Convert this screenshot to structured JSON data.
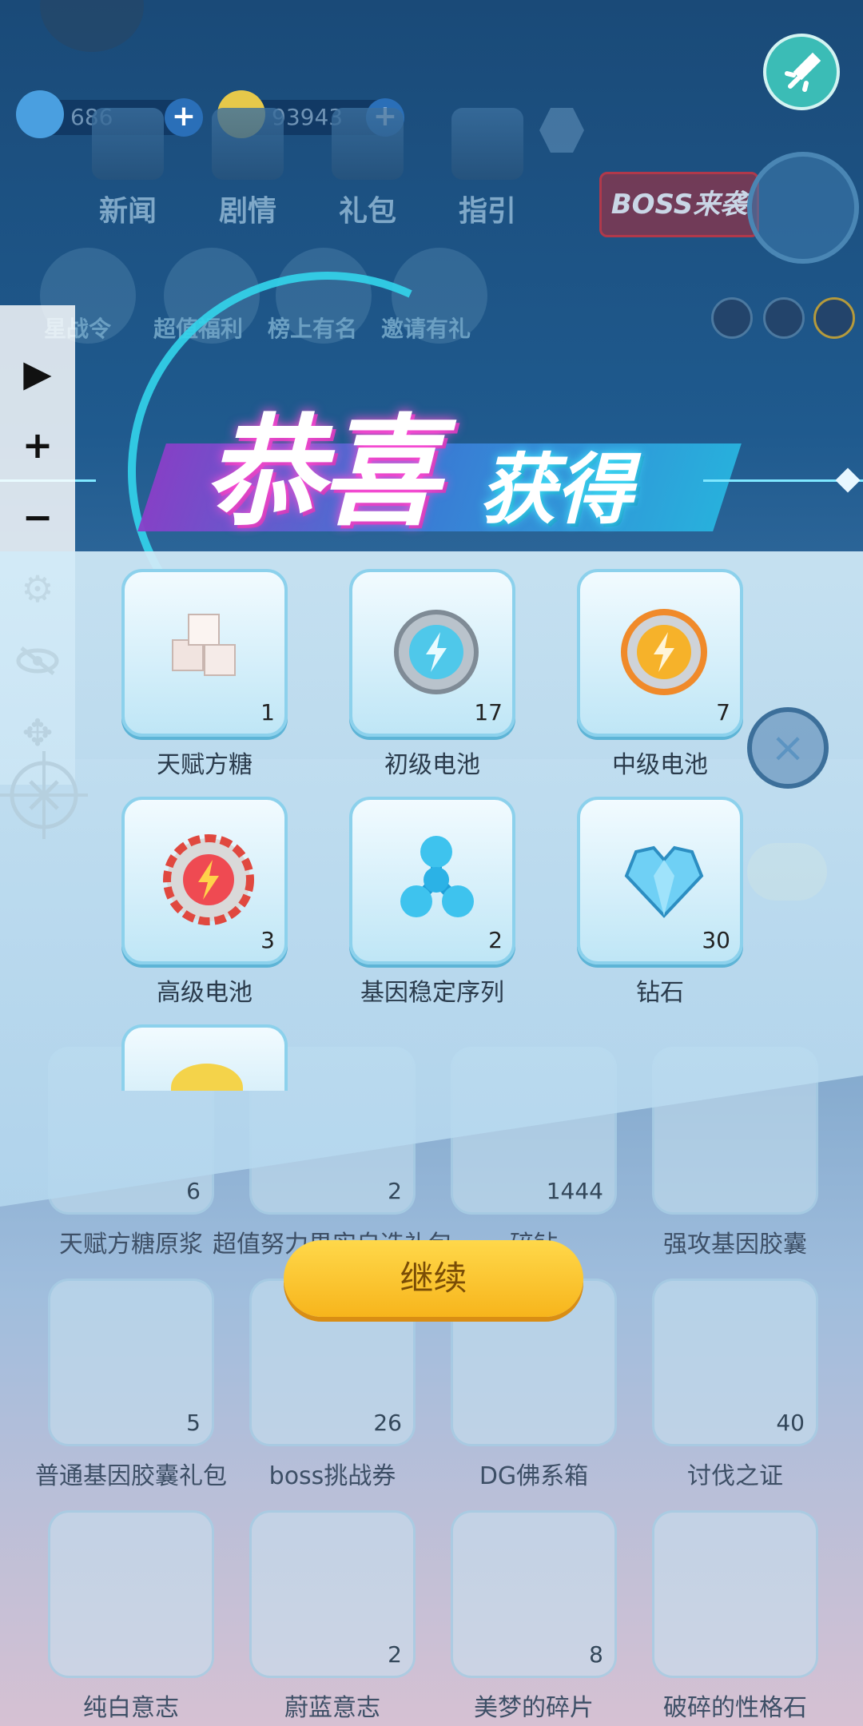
{
  "hud": {
    "gem_count": "686",
    "coin_count": "93943",
    "nav": [
      "新闻",
      "剧情",
      "礼包",
      "指引"
    ],
    "events": [
      "星战令",
      "超值福利",
      "榜上有名",
      "邀请有礼"
    ],
    "boss_label": "BOSS来袭"
  },
  "tools": [
    "play-icon",
    "plus-icon",
    "minus-icon",
    "gear-icon",
    "eye-off-icon",
    "move-icon",
    "crosshair-icon"
  ],
  "banner": {
    "title_a": "恭喜",
    "title_b": "获得"
  },
  "rewards": [
    {
      "name": "天赋方糖",
      "count": "1",
      "icon": "sugar-cube-icon"
    },
    {
      "name": "初级电池",
      "count": "17",
      "icon": "battery-blue-icon"
    },
    {
      "name": "中级电池",
      "count": "7",
      "icon": "battery-orange-icon"
    },
    {
      "name": "高级电池",
      "count": "3",
      "icon": "battery-red-icon"
    },
    {
      "name": "基因稳定序列",
      "count": "2",
      "icon": "molecule-icon"
    },
    {
      "name": "钻石",
      "count": "30",
      "icon": "diamond-heart-icon"
    }
  ],
  "background_grid": [
    {
      "name": "天赋方糖原浆",
      "count": "6"
    },
    {
      "name": "超值努力果实自选礼包",
      "count": "2"
    },
    {
      "name": "碎钻",
      "count": "1444"
    },
    {
      "name": "强攻基因胶囊",
      "count": ""
    },
    {
      "name": "普通基因胶囊礼包",
      "count": "5"
    },
    {
      "name": "boss挑战券",
      "count": "26"
    },
    {
      "name": "DG佛系箱",
      "count": ""
    },
    {
      "name": "讨伐之证",
      "count": "40"
    },
    {
      "name": "纯白意志",
      "count": ""
    },
    {
      "name": "蔚蓝意志",
      "count": "2"
    },
    {
      "name": "美梦的碎片",
      "count": "8"
    },
    {
      "name": "破碎的性格石",
      "count": ""
    }
  ],
  "continue_label": "继续",
  "colors": {
    "accent": "#33d5ec",
    "button": "#f7b51c",
    "panel": "#d2ebf8"
  }
}
